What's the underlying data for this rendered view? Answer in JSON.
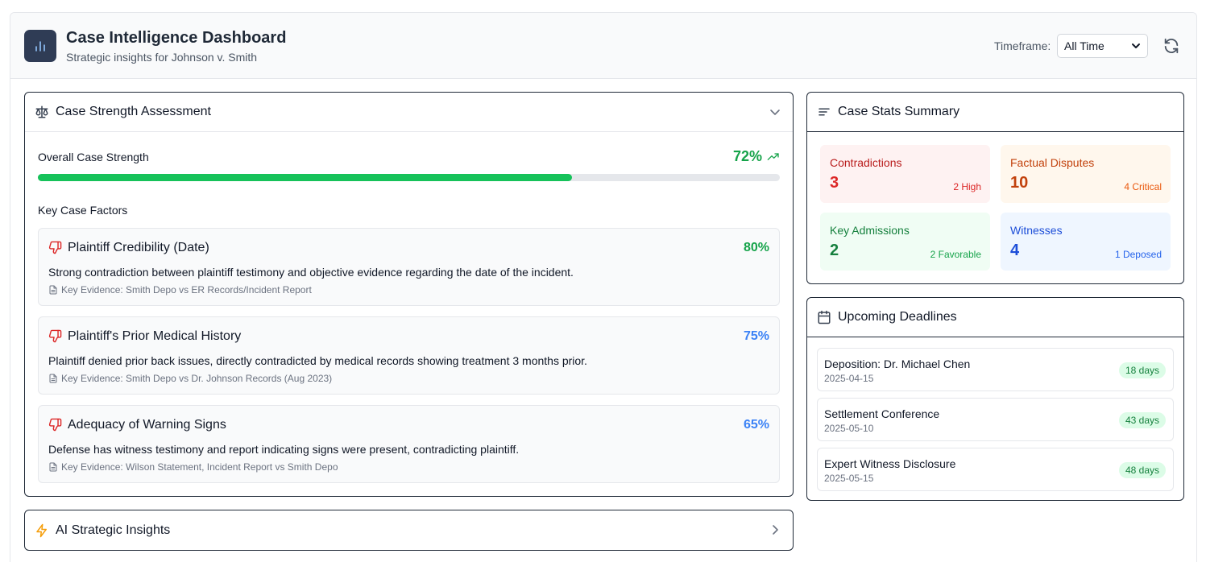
{
  "header": {
    "title": "Case Intelligence Dashboard",
    "subtitle": "Strategic insights for Johnson v. Smith",
    "timeframe_label": "Timeframe:",
    "timeframe_value": "All Time",
    "icons": {
      "logo": "bar-chart-icon",
      "refresh": "refresh-icon"
    }
  },
  "strength": {
    "title": "Case Strength Assessment",
    "overall_label": "Overall Case Strength",
    "overall_value": "72%",
    "overall_fraction": 0.72,
    "factors_title": "Key Case Factors",
    "factors": [
      {
        "name": "Plaintiff Credibility (Date)",
        "value": "80%",
        "color": "#16a34a",
        "description": "Strong contradiction between plaintiff testimony and objective evidence regarding the date of the incident.",
        "evidence": "Key Evidence: Smith Depo vs ER Records/Incident Report"
      },
      {
        "name": "Plaintiff's Prior Medical History",
        "value": "75%",
        "color": "#3b82f6",
        "description": "Plaintiff denied prior back issues, directly contradicted by medical records showing treatment 3 months prior.",
        "evidence": "Key Evidence: Smith Depo vs Dr. Johnson Records (Aug 2023)"
      },
      {
        "name": "Adequacy of Warning Signs",
        "value": "65%",
        "color": "#3b82f6",
        "description": "Defense has witness testimony and report indicating signs were present, contradicting plaintiff.",
        "evidence": "Key Evidence: Wilson Statement, Incident Report vs Smith Depo"
      }
    ]
  },
  "insights": {
    "title": "AI Strategic Insights"
  },
  "stats": {
    "title": "Case Stats Summary",
    "items": [
      {
        "label": "Contradictions",
        "value": "3",
        "sub": "2 High",
        "bg": "#fef2f2",
        "fg": "#dc2626",
        "label_color": "#b91c1c"
      },
      {
        "label": "Factual Disputes",
        "value": "10",
        "sub": "4 Critical",
        "bg": "#fff7ed",
        "fg": "#c2410c",
        "label_color": "#c2410c"
      },
      {
        "label": "Key Admissions",
        "value": "2",
        "sub": "2 Favorable",
        "bg": "#f0fdf4",
        "fg": "#15803d",
        "label_color": "#15803d"
      },
      {
        "label": "Witnesses",
        "value": "4",
        "sub": "1 Deposed",
        "bg": "#eff6ff",
        "fg": "#1d4ed8",
        "label_color": "#1d4ed8"
      }
    ]
  },
  "deadlines": {
    "title": "Upcoming Deadlines",
    "items": [
      {
        "title": "Deposition: Dr. Michael Chen",
        "date": "2025-04-15",
        "badge": "18 days"
      },
      {
        "title": "Settlement Conference",
        "date": "2025-05-10",
        "badge": "43 days"
      },
      {
        "title": "Expert Witness Disclosure",
        "date": "2025-05-15",
        "badge": "48 days"
      }
    ]
  }
}
